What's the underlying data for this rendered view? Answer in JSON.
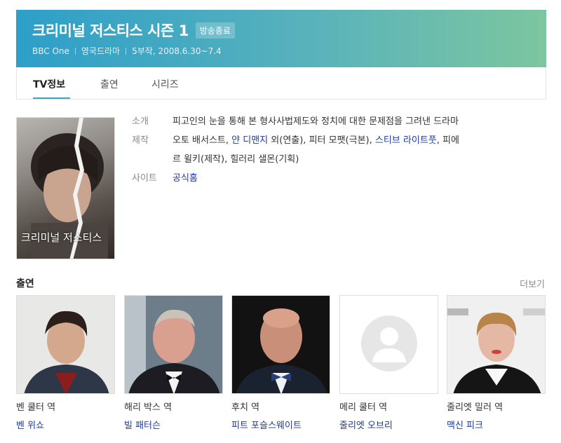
{
  "header": {
    "title": "크리미널 저스티스 시즌 1",
    "badge": "방송종료",
    "channel": "BBC One",
    "genre": "영국드라마",
    "episodes_dates": "5부작, 2008.6.30~7.4"
  },
  "tabs": [
    {
      "label": "TV정보",
      "active": true
    },
    {
      "label": "출연",
      "active": false
    },
    {
      "label": "시리즈",
      "active": false
    }
  ],
  "poster": {
    "caption": "크리미널 저스티스"
  },
  "info": {
    "intro_label": "소개",
    "intro_text": "피고인의 눈을 통해 본 형사사법제도와 정치에 대한 문제점을 그려낸 드라마",
    "production_label": "제작",
    "production": {
      "p1": "오토 배서스트, ",
      "p2": "얀 디맨지",
      "p3": " 외(연출), 피터 모팻(극본), ",
      "p4": "스티브 라이트풋",
      "p5": ", 피에",
      "p6": "르 윌키(제작), 힐러리 샐몬(기획)"
    },
    "site_label": "사이트",
    "site_link": "공식홈"
  },
  "cast_section": {
    "title": "출연",
    "more": "더보기"
  },
  "cast": [
    {
      "role": "벤 쿨터 역",
      "name": "벤 위쇼"
    },
    {
      "role": "해리 박스 역",
      "name": "빌 패터슨"
    },
    {
      "role": "후치 역",
      "name": "피트 포슬스웨이트"
    },
    {
      "role": "메리 쿨터 역",
      "name": "줄리엣 오브리"
    },
    {
      "role": "줄리엣 밀러 역",
      "name": "맥신 피크"
    }
  ],
  "colors": {
    "link": "#1e3a9e",
    "accent": "#3aa8b8",
    "header_start": "#2d9fc9",
    "header_end": "#7cc69f"
  },
  "icons": {
    "placeholder": "person-silhouette-icon"
  }
}
